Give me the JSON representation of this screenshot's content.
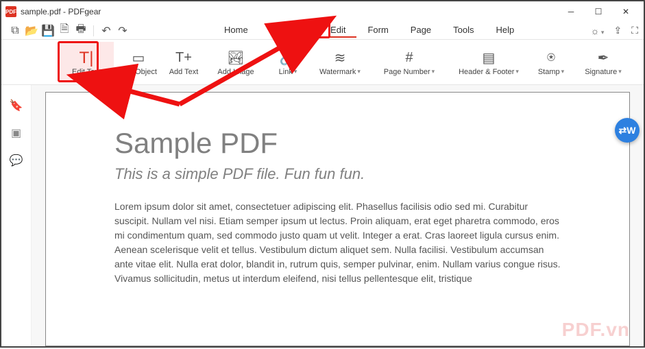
{
  "title": "sample.pdf - PDFgear",
  "appIconText": "PDF",
  "winControls": [
    "minimize",
    "maximize",
    "close"
  ],
  "quickAccess": [
    "new",
    "open",
    "save",
    "save-as",
    "print",
    "",
    "undo",
    "redo"
  ],
  "mainTabs": [
    "Home",
    "Comment",
    "Edit",
    "Form",
    "Page",
    "Tools",
    "Help"
  ],
  "mainTabActive": 2,
  "rightIcons": [
    "brightness",
    "share",
    "fullscreen"
  ],
  "ribbon": [
    {
      "icon": "T|",
      "label": "Edit Text",
      "dd": false,
      "highlight": true,
      "w": "wide"
    },
    {
      "icon": "▭",
      "label": "Edit Object",
      "dd": false
    },
    {
      "icon": "T+",
      "label": "Add Text",
      "dd": false
    },
    {
      "icon": "🏞",
      "label": "Add Image",
      "dd": false,
      "w": "wide"
    },
    {
      "icon": "🔗",
      "label": "Link",
      "dd": true
    },
    {
      "icon": "≋",
      "label": "Watermark",
      "dd": true,
      "w": "wide"
    },
    {
      "icon": "#",
      "label": "Page Number",
      "dd": true,
      "w": "wider"
    },
    {
      "icon": "▤",
      "label": "Header & Footer",
      "dd": true,
      "w": "wider"
    },
    {
      "icon": "⍟",
      "label": "Stamp",
      "dd": true
    },
    {
      "icon": "✒",
      "label": "Signature",
      "dd": true,
      "w": "wide"
    }
  ],
  "sidebarIcons": [
    "bookmark",
    "thumbnails",
    "comments"
  ],
  "doc": {
    "h1": "Sample PDF",
    "h2": "This is a simple PDF file. Fun fun fun.",
    "body": "Lorem ipsum dolor sit amet, consectetuer adipiscing elit. Phasellus facilisis odio sed mi. Curabitur suscipit. Nullam vel nisi. Etiam semper ipsum ut lectus. Proin aliquam, erat eget pharetra commodo, eros mi condimentum quam, sed commodo justo quam ut velit. Integer a erat. Cras laoreet ligula cursus enim. Aenean scelerisque velit et tellus. Vestibulum dictum aliquet sem. Nulla facilisi. Vestibulum accumsan ante vitae elit. Nulla erat dolor, blandit in, rutrum quis, semper pulvinar, enim. Nullam varius congue risus. Vivamus sollicitudin, metus ut interdum eleifend, nisi tellus pellentesque elit, tristique"
  },
  "watermark": "PDF.vn",
  "floatingIcon": "W"
}
